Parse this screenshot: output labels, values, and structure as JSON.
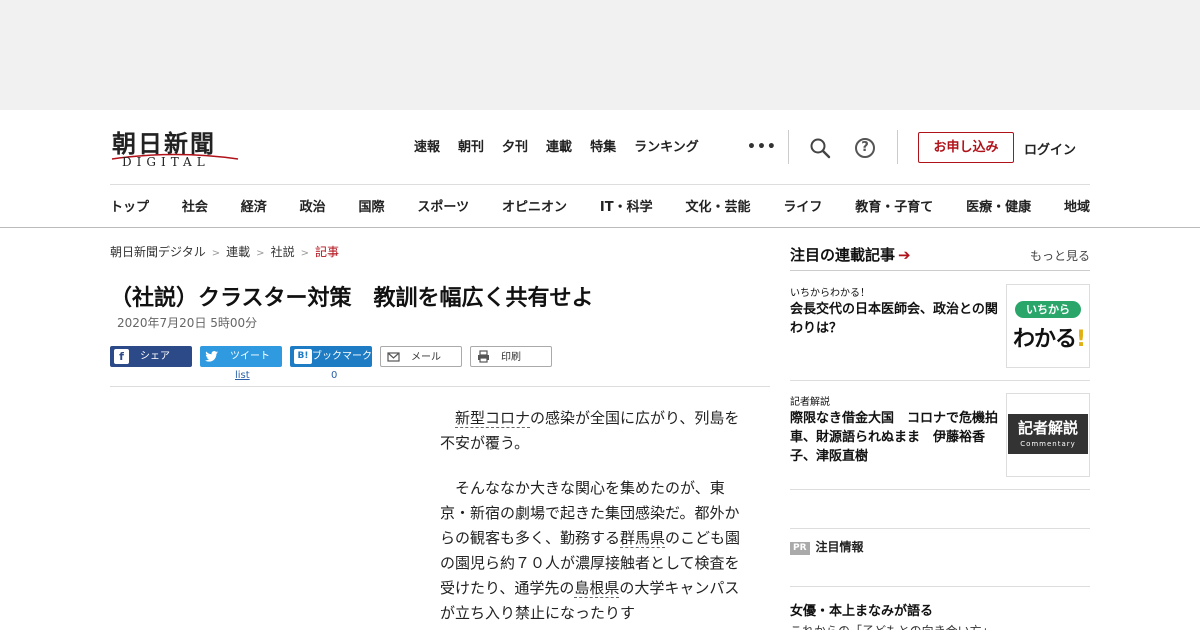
{
  "header": {
    "logo_kanji": "朝日新聞",
    "logo_sub": "DIGITAL",
    "top_nav": [
      "速報",
      "朝刊",
      "夕刊",
      "連載",
      "特集",
      "ランキング"
    ],
    "more": "•••",
    "help": "?",
    "signup": "お申し込み",
    "login": "ログイン",
    "categories": [
      "トップ",
      "社会",
      "経済",
      "政治",
      "国際",
      "スポーツ",
      "オピニオン",
      "IT・科学",
      "文化・芸能",
      "ライフ",
      "教育・子育て",
      "医療・健康",
      "地域"
    ]
  },
  "breadcrumb": {
    "items": [
      "朝日新聞デジタル",
      "連載",
      "社説"
    ],
    "current": "記事",
    "sep": ">"
  },
  "article": {
    "title": "（社説）クラスター対策　教訓を幅広く共有せよ",
    "date": "2020年7月20日 5時00分",
    "p1_link": "新型コロナ",
    "p1_rest": "の感染が全国に広がり、列島を不安が覆う。",
    "p2_a": "そんななか大きな関心を集めたのが、東京・新宿の劇場で起きた集団感染だ。都外からの観客も多く、勤務する",
    "p2_link1": "群馬県",
    "p2_b": "のこども園の園児ら約７０人が濃厚接触者として検査を受けたり、通学先の",
    "p2_link2": "島根県",
    "p2_c": "の大学キャンパスが立ち入り禁止になったりす"
  },
  "share": {
    "facebook": "シェア",
    "twitter": "ツイート",
    "hatena": "ブックマーク",
    "mail": "メール",
    "print": "印刷",
    "twitter_sub": "list",
    "hatena_count": "0"
  },
  "sidebar": {
    "heading": "注目の連載記事",
    "more": "もっと見る",
    "cards": [
      {
        "tag": "いちからわかる！",
        "title": "会長交代の日本医師会、政治との関わりは？",
        "thumb_pill": "いちから",
        "thumb_text": "わかる",
        "thumb_bang": "!"
      },
      {
        "tag": "記者解説",
        "title": "際限なき借金大国　コロナで危機拍車、財源語られぬまま　伊藤裕香子、津阪直樹",
        "thumb_main": "記者解説",
        "thumb_sub": "Commentary"
      }
    ],
    "pr_badge": "PR",
    "pr_label": "注目情報",
    "promo_title": "女優・本上まなみが語る",
    "promo_sub": "これからの「子どもとの向き合い方」"
  },
  "colors": {
    "accent_red": "#b0121a",
    "facebook": "#2d4a88",
    "twitter": "#2f9ae0",
    "hatena": "#1e7cc4"
  }
}
